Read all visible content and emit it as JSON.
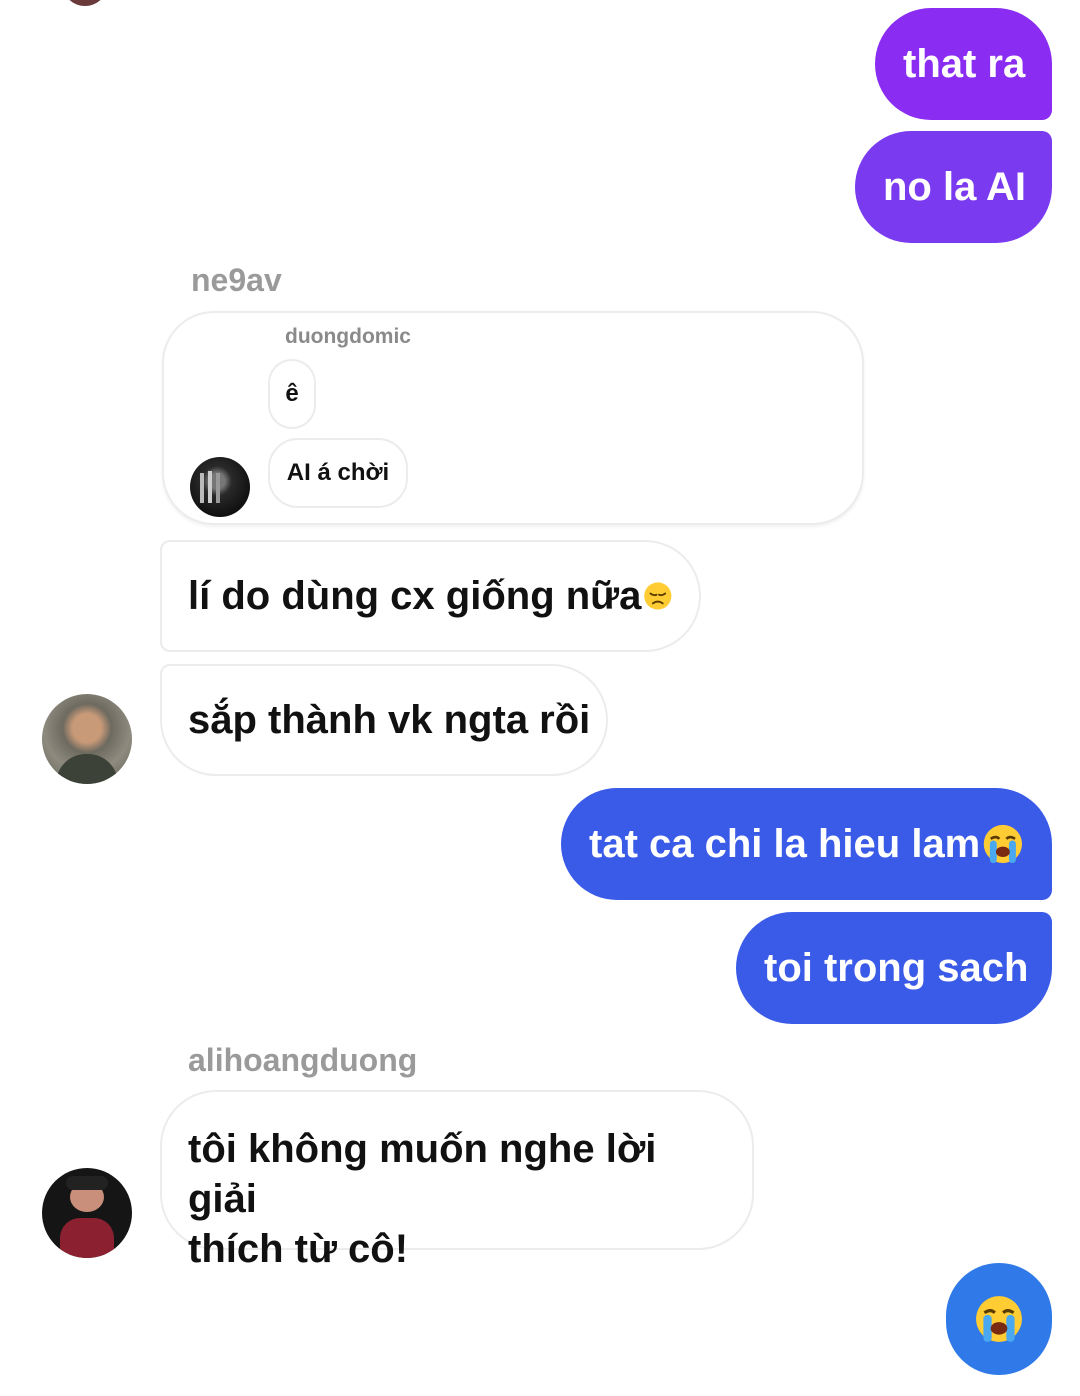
{
  "colors": {
    "outgoing_purple": "#8a2cf2",
    "outgoing_violet": "#7a3af0",
    "outgoing_blue": "#3a5ae8",
    "incoming_border": "#ececec",
    "sender_name": "#9a9a9a"
  },
  "messages": {
    "m1": "that ra",
    "m2": "no la AI",
    "sender_ne9av": "ne9av",
    "reply_to_name": "duongdomic",
    "reply_line1": "ê",
    "reply_line2": "AI á chời",
    "m3": "lí do dùng cx giống nữa",
    "m3_emoji": "disappointed-face-icon",
    "m4": "sắp thành vk ngta rồi",
    "m5": "tat ca chi la hieu lam",
    "m5_emoji": "loudly-crying-face-icon",
    "m6": "toi trong sach",
    "sender_ali": "alihoangduong",
    "m7_line1": "tôi không muốn nghe lời giải",
    "m7_line2": "thích từ cô!",
    "reaction_emoji": "loudly-crying-face-icon"
  }
}
